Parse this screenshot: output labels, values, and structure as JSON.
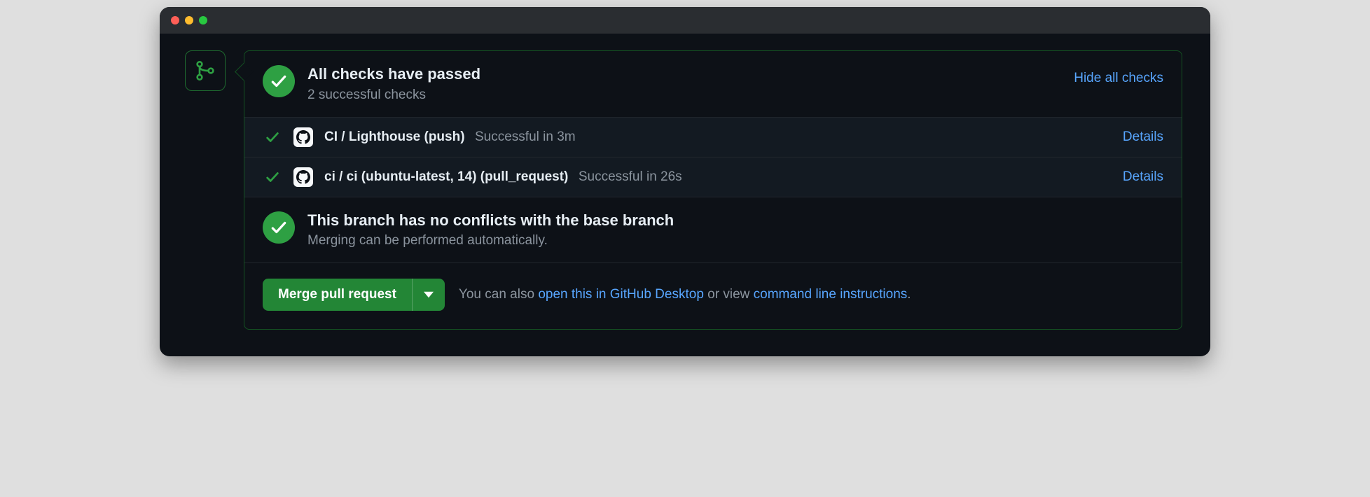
{
  "checks_summary": {
    "title": "All checks have passed",
    "subtitle": "2 successful checks",
    "toggle_label": "Hide all checks"
  },
  "checks": [
    {
      "name": "CI / Lighthouse (push)",
      "status": "Successful in 3m",
      "details_label": "Details"
    },
    {
      "name": "ci / ci (ubuntu-latest, 14) (pull_request)",
      "status": "Successful in 26s",
      "details_label": "Details"
    }
  ],
  "conflicts": {
    "title": "This branch has no conflicts with the base branch",
    "subtitle": "Merging can be performed automatically."
  },
  "merge": {
    "button_label": "Merge pull request",
    "hint_prefix": "You can also ",
    "open_desktop": "open this in GitHub Desktop",
    "hint_mid": " or view ",
    "cmd_line": "command line instructions",
    "hint_suffix": "."
  }
}
